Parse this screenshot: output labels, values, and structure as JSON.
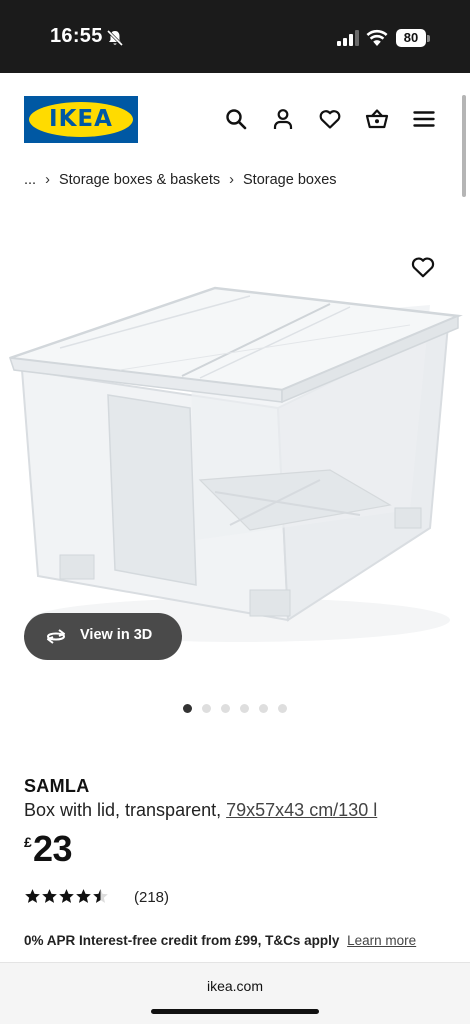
{
  "status_bar": {
    "time": "16:55",
    "battery": "80"
  },
  "header": {
    "logo_text": "IKEA",
    "icons": [
      "search-icon",
      "user-icon",
      "heart-icon",
      "basket-icon",
      "menu-icon"
    ]
  },
  "breadcrumb": {
    "ellipsis": "...",
    "items": [
      "Storage boxes & baskets",
      "Storage boxes"
    ]
  },
  "gallery": {
    "view3d_label": "View in 3D",
    "dot_count": 6,
    "active_index": 0
  },
  "product": {
    "name": "SAMLA",
    "description": "Box with lid, transparent,",
    "dimensions": "79x57x43 cm/130 l",
    "currency": "£",
    "price": "23",
    "rating": 4.5,
    "rating_max": 5,
    "review_count": "(218)",
    "apr_text": "0% APR Interest-free credit from £99, T&Cs apply",
    "apr_link": "Learn more"
  },
  "browser": {
    "url": "ikea.com"
  },
  "colors": {
    "ikea_blue": "#0058a3",
    "ikea_yellow": "#ffdb00",
    "status_bar": "#1b1b1b",
    "pill": "#4a4a4a"
  }
}
